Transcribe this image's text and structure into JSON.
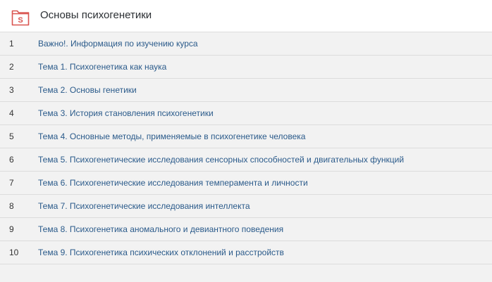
{
  "header": {
    "title": "Основы психогенетики",
    "icon": "scorm-package-icon",
    "icon_letter": "S",
    "accent_color": "#d9534f"
  },
  "items": [
    {
      "num": "1",
      "label": "Важно!. Информация по изучению курса"
    },
    {
      "num": "2",
      "label": "Тема 1. Психогенетика как наука"
    },
    {
      "num": "3",
      "label": "Тема 2. Основы генетики"
    },
    {
      "num": "4",
      "label": "Тема 3. История становления психогенетики"
    },
    {
      "num": "5",
      "label": "Тема 4. Основные методы, применяемые в психогенетике человека"
    },
    {
      "num": "6",
      "label": "Тема 5. Психогенетические исследования сенсорных способностей и двигательных функций"
    },
    {
      "num": "7",
      "label": "Тема 6. Психогенетические исследования темперамента и личности"
    },
    {
      "num": "8",
      "label": "Тема 7. Психогенетические исследования интеллекта"
    },
    {
      "num": "9",
      "label": "Тема 8. Психогенетика аномального и девиантного поведения"
    },
    {
      "num": "10",
      "label": "Тема 9. Психогенетика психических отклонений и расстройств"
    }
  ]
}
